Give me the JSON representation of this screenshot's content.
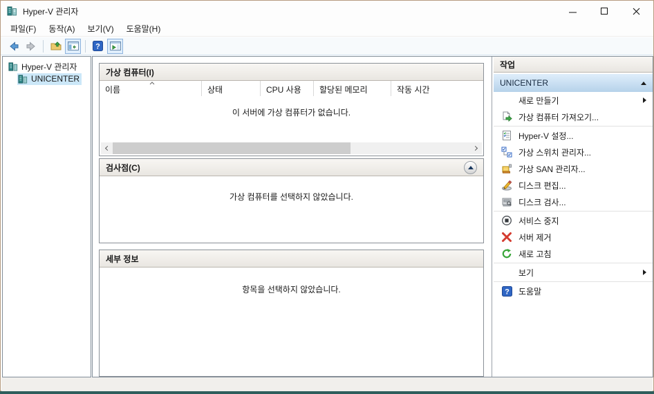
{
  "window": {
    "title": "Hyper-V 관리자"
  },
  "menu": {
    "items": [
      "파일(F)",
      "동작(A)",
      "보기(V)",
      "도움말(H)"
    ]
  },
  "toolbar": {
    "icons": [
      "back",
      "forward",
      "up-folder",
      "show-console-tree",
      "help",
      "show-action-pane"
    ]
  },
  "tree": {
    "root": "Hyper-V 관리자",
    "server": "UNICENTER"
  },
  "vm_section": {
    "title": "가상 컴퓨터(I)",
    "columns": [
      "이름",
      "상태",
      "CPU 사용",
      "할당된 메모리",
      "작동 시간"
    ],
    "empty_message": "이 서버에 가상 컴퓨터가 없습니다."
  },
  "checkpoints_section": {
    "title": "검사점(C)",
    "empty_message": "가상 컴퓨터를 선택하지 않았습니다."
  },
  "details_section": {
    "title": "세부 정보",
    "empty_message": "항목을 선택하지 않았습니다."
  },
  "actions": {
    "title": "작업",
    "group": "UNICENTER",
    "items": [
      {
        "label": "새로 만들기",
        "icon": "none",
        "submenu": true
      },
      {
        "label": "가상 컴퓨터 가져오기...",
        "icon": "import-vm"
      },
      {
        "label": "Hyper-V 설정...",
        "icon": "hyperv-settings"
      },
      {
        "label": "가상 스위치 관리자...",
        "icon": "virtual-switch"
      },
      {
        "label": "가상 SAN 관리자...",
        "icon": "virtual-san"
      },
      {
        "label": "디스크 편집...",
        "icon": "edit-disk"
      },
      {
        "label": "디스크 검사...",
        "icon": "inspect-disk"
      },
      {
        "label": "서비스 중지",
        "icon": "stop-service"
      },
      {
        "label": "서버 제거",
        "icon": "remove-server"
      },
      {
        "label": "새로 고침",
        "icon": "refresh"
      },
      {
        "label": "보기",
        "icon": "none",
        "submenu": true
      },
      {
        "label": "도움말",
        "icon": "help"
      }
    ]
  },
  "colors": {
    "window_border": "#b69b80",
    "selection": "#cbe7f8",
    "action_group_top": "#dfeefb",
    "action_group_bottom": "#b6d2ea",
    "header_top": "#f8f6f3",
    "header_bottom": "#e9e6e1"
  }
}
